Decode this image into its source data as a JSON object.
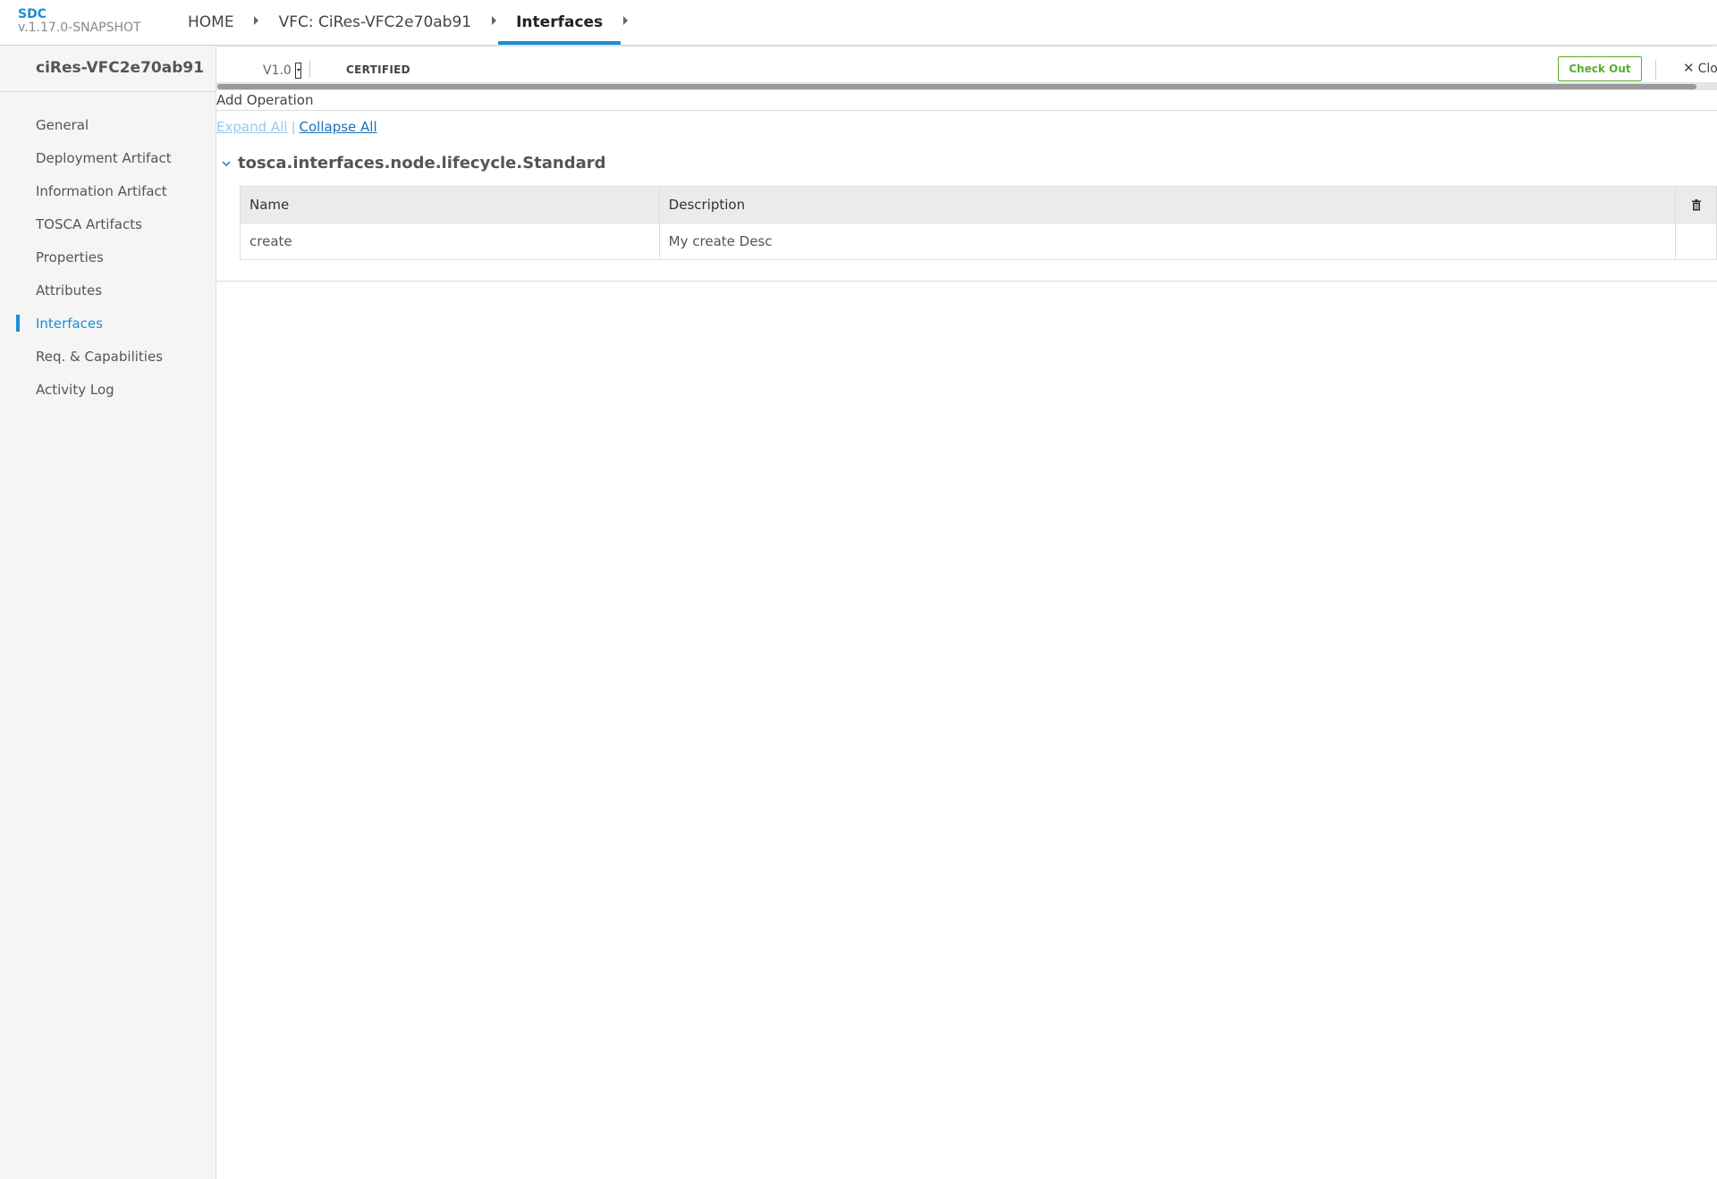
{
  "header": {
    "brand_name": "SDC",
    "brand_version": "v.1.17.0-SNAPSHOT",
    "breadcrumbs": [
      {
        "label": "HOME"
      },
      {
        "label": "VFC: CiRes-VFC2e70ab91"
      },
      {
        "label": "Interfaces"
      }
    ]
  },
  "sidebar": {
    "title": "ciRes-VFC2e70ab91",
    "items": [
      {
        "label": "General"
      },
      {
        "label": "Deployment Artifact"
      },
      {
        "label": "Information Artifact"
      },
      {
        "label": "TOSCA Artifacts"
      },
      {
        "label": "Properties"
      },
      {
        "label": "Attributes"
      },
      {
        "label": "Interfaces"
      },
      {
        "label": "Req. & Capabilities"
      },
      {
        "label": "Activity Log"
      }
    ],
    "active_item": "Interfaces"
  },
  "toolbar": {
    "version": "V1.0",
    "status": "CERTIFIED",
    "checkout_label": "Check Out",
    "close_label": "Clo"
  },
  "content": {
    "add_operation_label": "Add Operation",
    "expand_all_label": "Expand All",
    "separator": "|",
    "collapse_all_label": "Collapse All",
    "interface_name": "tosca.interfaces.node.lifecycle.Standard",
    "table": {
      "headers": [
        "Name",
        "Description"
      ],
      "rows": [
        {
          "name": "create",
          "description": "My create Desc"
        }
      ]
    }
  },
  "colors": {
    "accent": "#1a8fd6",
    "checkout": "#5aad2e",
    "sidebar_bg": "#f5f5f5",
    "table_header_bg": "#ebebeb"
  },
  "icons": [
    "chevron-right-icon",
    "chevron-down-icon",
    "caret-down-icon",
    "close-icon",
    "trash-icon"
  ]
}
